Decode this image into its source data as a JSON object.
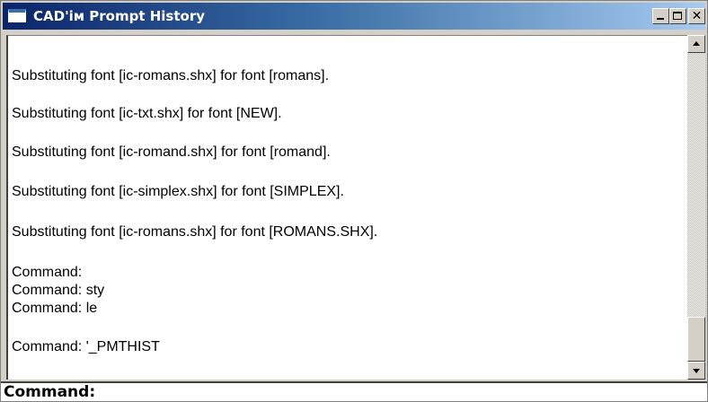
{
  "window": {
    "title": "CAD'ім Prompt History",
    "controls": {
      "minimize_glyph": "",
      "maximize_glyph": "",
      "close_glyph": "✕"
    },
    "icon": "app-window-icon"
  },
  "history": {
    "lines": [
      "Substituting font [ic-romans.shx] for font [romans].",
      "Substituting font [ic-txt.shx] for font [NEW].",
      "Substituting font [ic-romand.shx] for font [romand].",
      "Substituting font [ic-simplex.shx] for font [SIMPLEX].",
      "Substituting font [ic-romans.shx] for font [ROMANS.SHX].",
      "Command:",
      "Command: sty",
      "Command: le",
      "Command: '_PMTHIST"
    ]
  },
  "command_line": {
    "label": "Command:",
    "value": ""
  },
  "colors": {
    "title_gradient_start": "#0a246a",
    "title_gradient_end": "#a6caf0",
    "face": "#d4d0c8"
  }
}
